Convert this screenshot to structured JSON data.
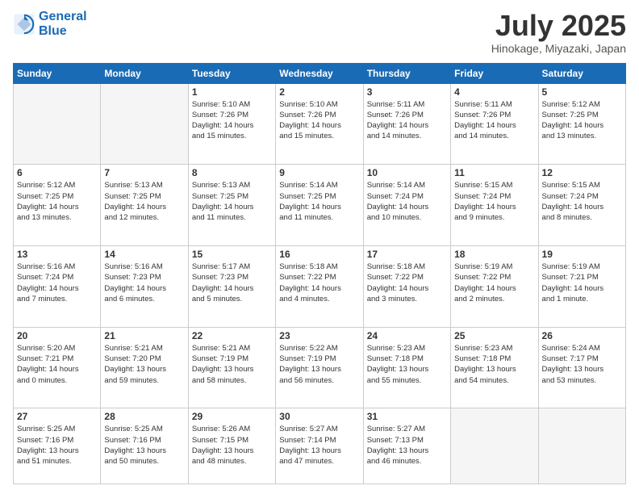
{
  "logo": {
    "line1": "General",
    "line2": "Blue"
  },
  "header": {
    "month": "July 2025",
    "location": "Hinokage, Miyazaki, Japan"
  },
  "weekdays": [
    "Sunday",
    "Monday",
    "Tuesday",
    "Wednesday",
    "Thursday",
    "Friday",
    "Saturday"
  ],
  "weeks": [
    [
      {
        "day": "",
        "info": ""
      },
      {
        "day": "",
        "info": ""
      },
      {
        "day": "1",
        "info": "Sunrise: 5:10 AM\nSunset: 7:26 PM\nDaylight: 14 hours\nand 15 minutes."
      },
      {
        "day": "2",
        "info": "Sunrise: 5:10 AM\nSunset: 7:26 PM\nDaylight: 14 hours\nand 15 minutes."
      },
      {
        "day": "3",
        "info": "Sunrise: 5:11 AM\nSunset: 7:26 PM\nDaylight: 14 hours\nand 14 minutes."
      },
      {
        "day": "4",
        "info": "Sunrise: 5:11 AM\nSunset: 7:26 PM\nDaylight: 14 hours\nand 14 minutes."
      },
      {
        "day": "5",
        "info": "Sunrise: 5:12 AM\nSunset: 7:25 PM\nDaylight: 14 hours\nand 13 minutes."
      }
    ],
    [
      {
        "day": "6",
        "info": "Sunrise: 5:12 AM\nSunset: 7:25 PM\nDaylight: 14 hours\nand 13 minutes."
      },
      {
        "day": "7",
        "info": "Sunrise: 5:13 AM\nSunset: 7:25 PM\nDaylight: 14 hours\nand 12 minutes."
      },
      {
        "day": "8",
        "info": "Sunrise: 5:13 AM\nSunset: 7:25 PM\nDaylight: 14 hours\nand 11 minutes."
      },
      {
        "day": "9",
        "info": "Sunrise: 5:14 AM\nSunset: 7:25 PM\nDaylight: 14 hours\nand 11 minutes."
      },
      {
        "day": "10",
        "info": "Sunrise: 5:14 AM\nSunset: 7:24 PM\nDaylight: 14 hours\nand 10 minutes."
      },
      {
        "day": "11",
        "info": "Sunrise: 5:15 AM\nSunset: 7:24 PM\nDaylight: 14 hours\nand 9 minutes."
      },
      {
        "day": "12",
        "info": "Sunrise: 5:15 AM\nSunset: 7:24 PM\nDaylight: 14 hours\nand 8 minutes."
      }
    ],
    [
      {
        "day": "13",
        "info": "Sunrise: 5:16 AM\nSunset: 7:24 PM\nDaylight: 14 hours\nand 7 minutes."
      },
      {
        "day": "14",
        "info": "Sunrise: 5:16 AM\nSunset: 7:23 PM\nDaylight: 14 hours\nand 6 minutes."
      },
      {
        "day": "15",
        "info": "Sunrise: 5:17 AM\nSunset: 7:23 PM\nDaylight: 14 hours\nand 5 minutes."
      },
      {
        "day": "16",
        "info": "Sunrise: 5:18 AM\nSunset: 7:22 PM\nDaylight: 14 hours\nand 4 minutes."
      },
      {
        "day": "17",
        "info": "Sunrise: 5:18 AM\nSunset: 7:22 PM\nDaylight: 14 hours\nand 3 minutes."
      },
      {
        "day": "18",
        "info": "Sunrise: 5:19 AM\nSunset: 7:22 PM\nDaylight: 14 hours\nand 2 minutes."
      },
      {
        "day": "19",
        "info": "Sunrise: 5:19 AM\nSunset: 7:21 PM\nDaylight: 14 hours\nand 1 minute."
      }
    ],
    [
      {
        "day": "20",
        "info": "Sunrise: 5:20 AM\nSunset: 7:21 PM\nDaylight: 14 hours\nand 0 minutes."
      },
      {
        "day": "21",
        "info": "Sunrise: 5:21 AM\nSunset: 7:20 PM\nDaylight: 13 hours\nand 59 minutes."
      },
      {
        "day": "22",
        "info": "Sunrise: 5:21 AM\nSunset: 7:19 PM\nDaylight: 13 hours\nand 58 minutes."
      },
      {
        "day": "23",
        "info": "Sunrise: 5:22 AM\nSunset: 7:19 PM\nDaylight: 13 hours\nand 56 minutes."
      },
      {
        "day": "24",
        "info": "Sunrise: 5:23 AM\nSunset: 7:18 PM\nDaylight: 13 hours\nand 55 minutes."
      },
      {
        "day": "25",
        "info": "Sunrise: 5:23 AM\nSunset: 7:18 PM\nDaylight: 13 hours\nand 54 minutes."
      },
      {
        "day": "26",
        "info": "Sunrise: 5:24 AM\nSunset: 7:17 PM\nDaylight: 13 hours\nand 53 minutes."
      }
    ],
    [
      {
        "day": "27",
        "info": "Sunrise: 5:25 AM\nSunset: 7:16 PM\nDaylight: 13 hours\nand 51 minutes."
      },
      {
        "day": "28",
        "info": "Sunrise: 5:25 AM\nSunset: 7:16 PM\nDaylight: 13 hours\nand 50 minutes."
      },
      {
        "day": "29",
        "info": "Sunrise: 5:26 AM\nSunset: 7:15 PM\nDaylight: 13 hours\nand 48 minutes."
      },
      {
        "day": "30",
        "info": "Sunrise: 5:27 AM\nSunset: 7:14 PM\nDaylight: 13 hours\nand 47 minutes."
      },
      {
        "day": "31",
        "info": "Sunrise: 5:27 AM\nSunset: 7:13 PM\nDaylight: 13 hours\nand 46 minutes."
      },
      {
        "day": "",
        "info": ""
      },
      {
        "day": "",
        "info": ""
      }
    ]
  ]
}
